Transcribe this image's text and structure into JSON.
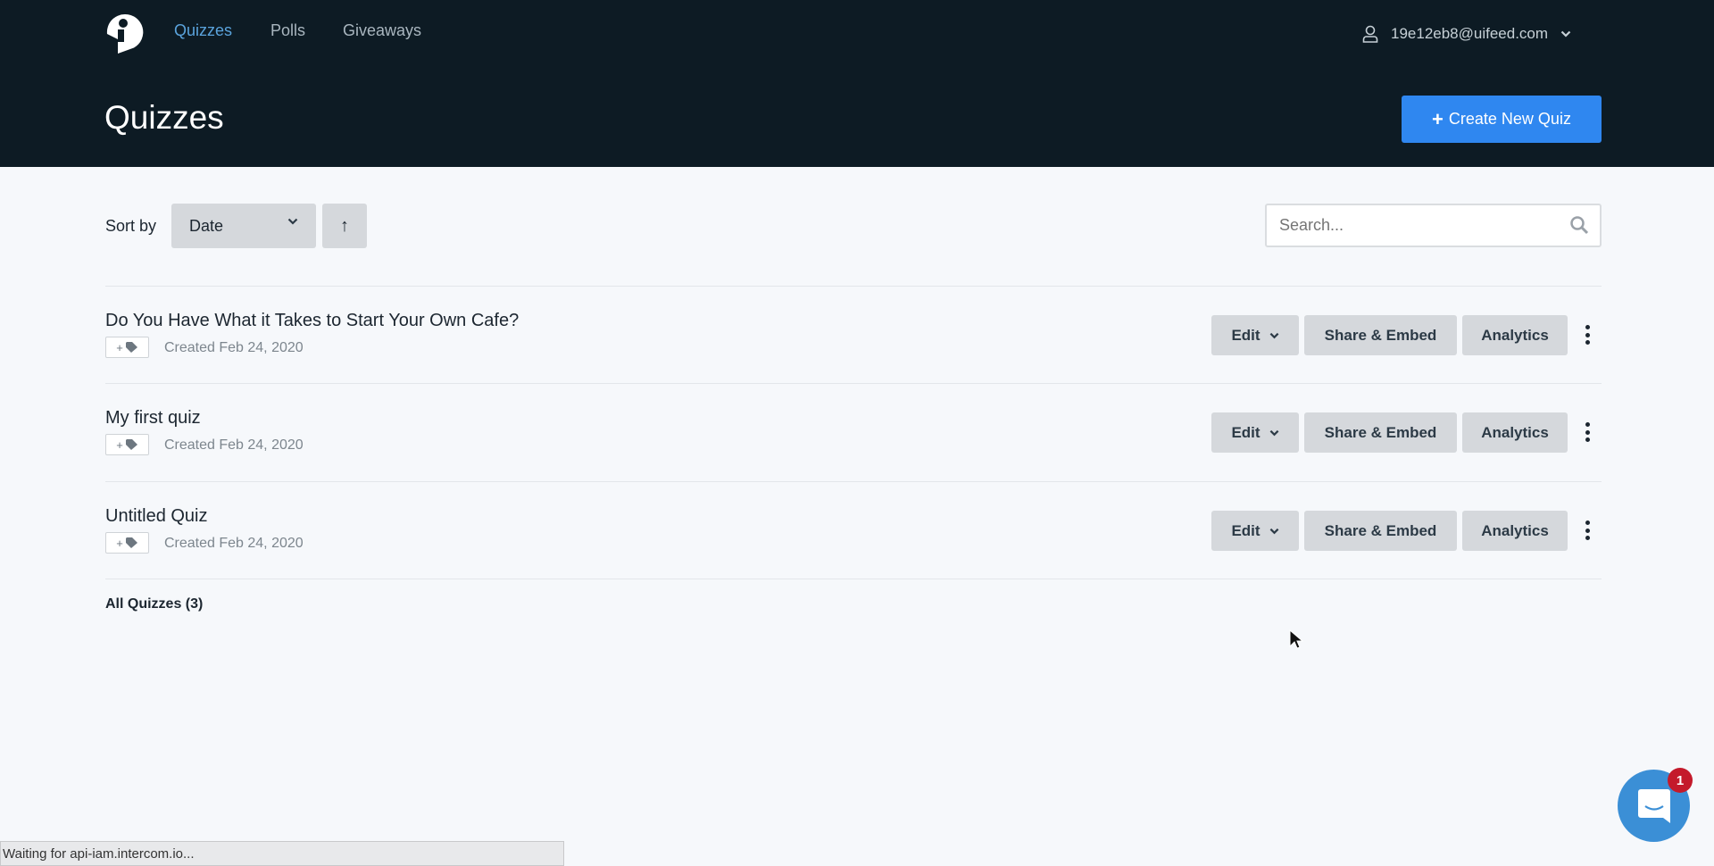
{
  "nav": {
    "items": [
      {
        "label": "Quizzes",
        "active": true
      },
      {
        "label": "Polls"
      },
      {
        "label": "Giveaways"
      }
    ],
    "user_email": "19e12eb8@uifeed.com"
  },
  "header": {
    "title": "Quizzes",
    "create_label": "Create New Quiz",
    "create_icon": "plus-icon"
  },
  "toolbar": {
    "sort_label": "Sort by",
    "sort_value": "Date",
    "sort_direction": "ascending",
    "search_placeholder": "Search...",
    "search_value": ""
  },
  "quizzes": [
    {
      "title": "Do You Have What it Takes to Start Your Own Cafe?",
      "created": "Created Feb 24, 2020"
    },
    {
      "title": "My first quiz",
      "created": "Created Feb 24, 2020"
    },
    {
      "title": "Untitled Quiz",
      "created": "Created Feb 24, 2020"
    }
  ],
  "actions": {
    "edit": "Edit",
    "share": "Share & Embed",
    "analytics": "Analytics",
    "tag_add": "+"
  },
  "footer": {
    "all_label": "All Quizzes (3)"
  },
  "status_bar": "Waiting for api-iam.intercom.io...",
  "chat": {
    "badge": "1"
  },
  "colors": {
    "header_bg": "#0d1b24",
    "accent": "#2f87f0",
    "nav_active": "#5aa3dc",
    "badge": "#c41a2b"
  }
}
